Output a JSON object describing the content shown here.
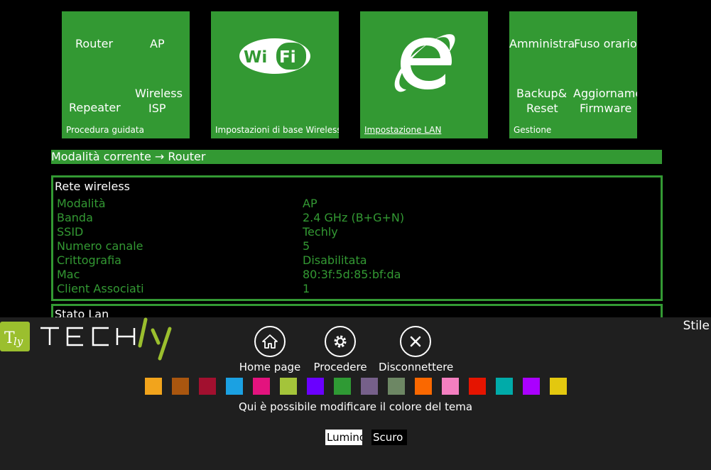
{
  "tiles": {
    "wizard": {
      "items": [
        "Router",
        "AP",
        "Repeater",
        "Wireless",
        "ISP"
      ],
      "caption": "Procedura guidata"
    },
    "wireless": {
      "logo_text": "WiFi",
      "caption": "Impostazioni di base Wireless"
    },
    "lan": {
      "caption": "Impostazione LAN"
    },
    "management": {
      "items": [
        "Amministra",
        "Fuso orario",
        "Backup&",
        "Reset",
        "Aggiorname",
        "Firmware"
      ],
      "caption": "Gestione"
    }
  },
  "mode_bar": {
    "text": "Modalità corrente → Router"
  },
  "wireless_panel": {
    "title": "Rete wireless",
    "rows": [
      {
        "label": "Modalità",
        "value": "AP"
      },
      {
        "label": "Banda",
        "value": "2.4 GHz (B+G+N)"
      },
      {
        "label": "SSID",
        "value": "Techly"
      },
      {
        "label": "Numero canale",
        "value": "5"
      },
      {
        "label": "Crittografia",
        "value": "Disabilitata"
      },
      {
        "label": "Mac",
        "value": "80:3f:5d:85:bf:da"
      },
      {
        "label": "Client Associati",
        "value": "1"
      }
    ]
  },
  "lan_panel": {
    "title": "Stato Lan"
  },
  "charm": {
    "style_label": "Stile",
    "logo_text": "TECHly",
    "actions": [
      {
        "label": "Home page",
        "icon": "home-icon"
      },
      {
        "label": "Procedere",
        "icon": "gear-icon"
      },
      {
        "label": "Disconnettere",
        "icon": "close-icon"
      }
    ],
    "swatches": [
      "#f2a41c",
      "#a9560f",
      "#a2102f",
      "#1ba1e2",
      "#e3137e",
      "#a4c43a",
      "#6a00ff",
      "#2f9a34",
      "#76608a",
      "#6d8764",
      "#fa6800",
      "#f47fc0",
      "#e51400",
      "#00aba9",
      "#aa00ff",
      "#e3c80f"
    ],
    "theme_hint": "Qui è possibile modificare il colore del tema",
    "light_label": "Luminoso",
    "dark_label": "Scuro"
  }
}
